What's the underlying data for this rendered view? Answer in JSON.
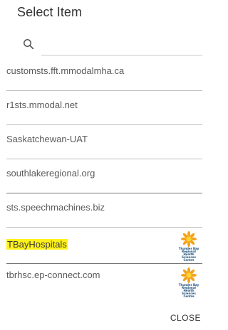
{
  "dialog": {
    "title": "Select Item",
    "search": {
      "icon": "search-icon",
      "value": "",
      "placeholder": ""
    },
    "items": [
      {
        "label": "customsts.fft.mmodalmha.ca",
        "logo": false
      },
      {
        "label": "r1sts.mmodal.net",
        "logo": false
      },
      {
        "label": "Saskatchewan-UAT",
        "logo": false
      },
      {
        "label": "southlakeregional.org",
        "logo": false
      },
      {
        "label": "sts.speechmachines.biz",
        "logo": false
      },
      {
        "label": "TBayHospitals",
        "logo": true,
        "highlighted": true
      },
      {
        "label": "tbrhsc.ep-connect.com",
        "logo": true
      }
    ],
    "logo_text": {
      "line1": "Thunder Bay Regional",
      "line2": "Health Sciences",
      "line3": "Centre"
    },
    "close_label": "CLOSE"
  },
  "colors": {
    "highlight": "#fff21a",
    "logo_orange": "#f5a21b",
    "logo_yellow": "#fbd431",
    "logo_text": "#1a4c7a"
  }
}
